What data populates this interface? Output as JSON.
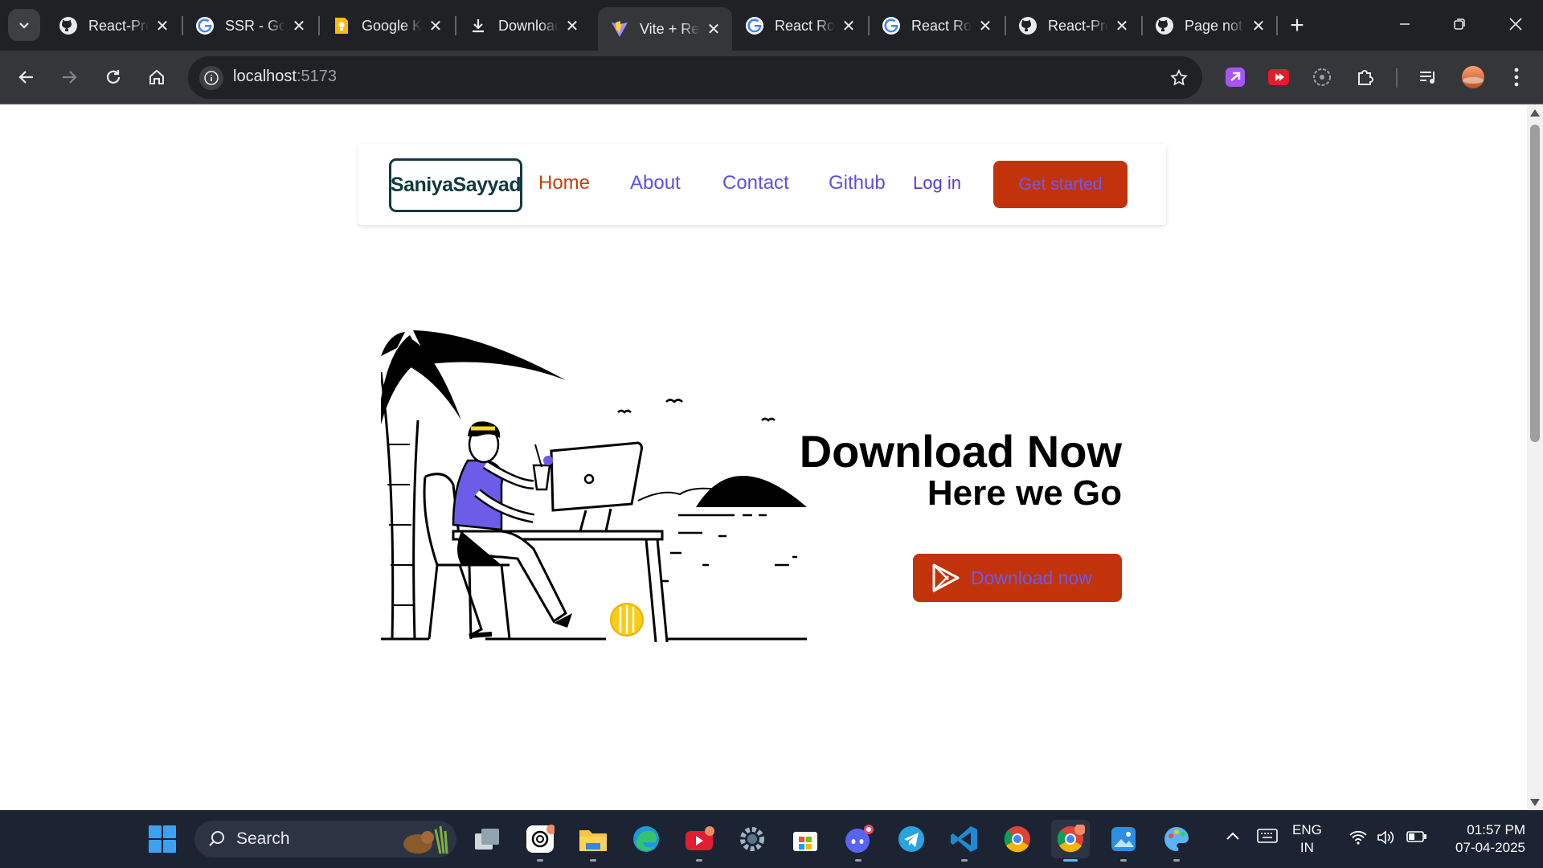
{
  "browser": {
    "tabs": [
      {
        "title": "React-Projects",
        "favicon": "github-icon",
        "active": false
      },
      {
        "title": "SSR - Google Search",
        "favicon": "google-icon",
        "active": false
      },
      {
        "title": "Google Keep",
        "favicon": "keep-icon",
        "active": false
      },
      {
        "title": "Downloads",
        "favicon": "download-icon",
        "active": false
      },
      {
        "title": "Vite + React",
        "favicon": "vite-icon",
        "active": true
      },
      {
        "title": "React Router",
        "favicon": "google-icon",
        "active": false
      },
      {
        "title": "React Router",
        "favicon": "google-icon",
        "active": false
      },
      {
        "title": "React-Projects",
        "favicon": "github-icon",
        "active": false
      },
      {
        "title": "Page not found",
        "favicon": "github-icon",
        "active": false
      }
    ],
    "url_host": "localhost",
    "url_port": ":5173"
  },
  "site": {
    "logo_text": "SaniyaSayyad",
    "nav": {
      "home": "Home",
      "about": "About",
      "contact": "Contact",
      "github": "Github"
    },
    "login": "Log in",
    "get_started": "Get started",
    "hero": {
      "title": "Download Now",
      "subtitle": "Here we Go",
      "download_button": "Download now"
    }
  },
  "taskbar": {
    "search_placeholder": "Search",
    "language": "ENG",
    "region": "IN",
    "time": "01:57 PM",
    "date": "07-04-2025"
  },
  "colors": {
    "accent_orange": "#c2330b",
    "link_purple": "#5b50e6",
    "logo_teal": "#0f3a3f",
    "taskbar_bg": "#1c2433"
  }
}
